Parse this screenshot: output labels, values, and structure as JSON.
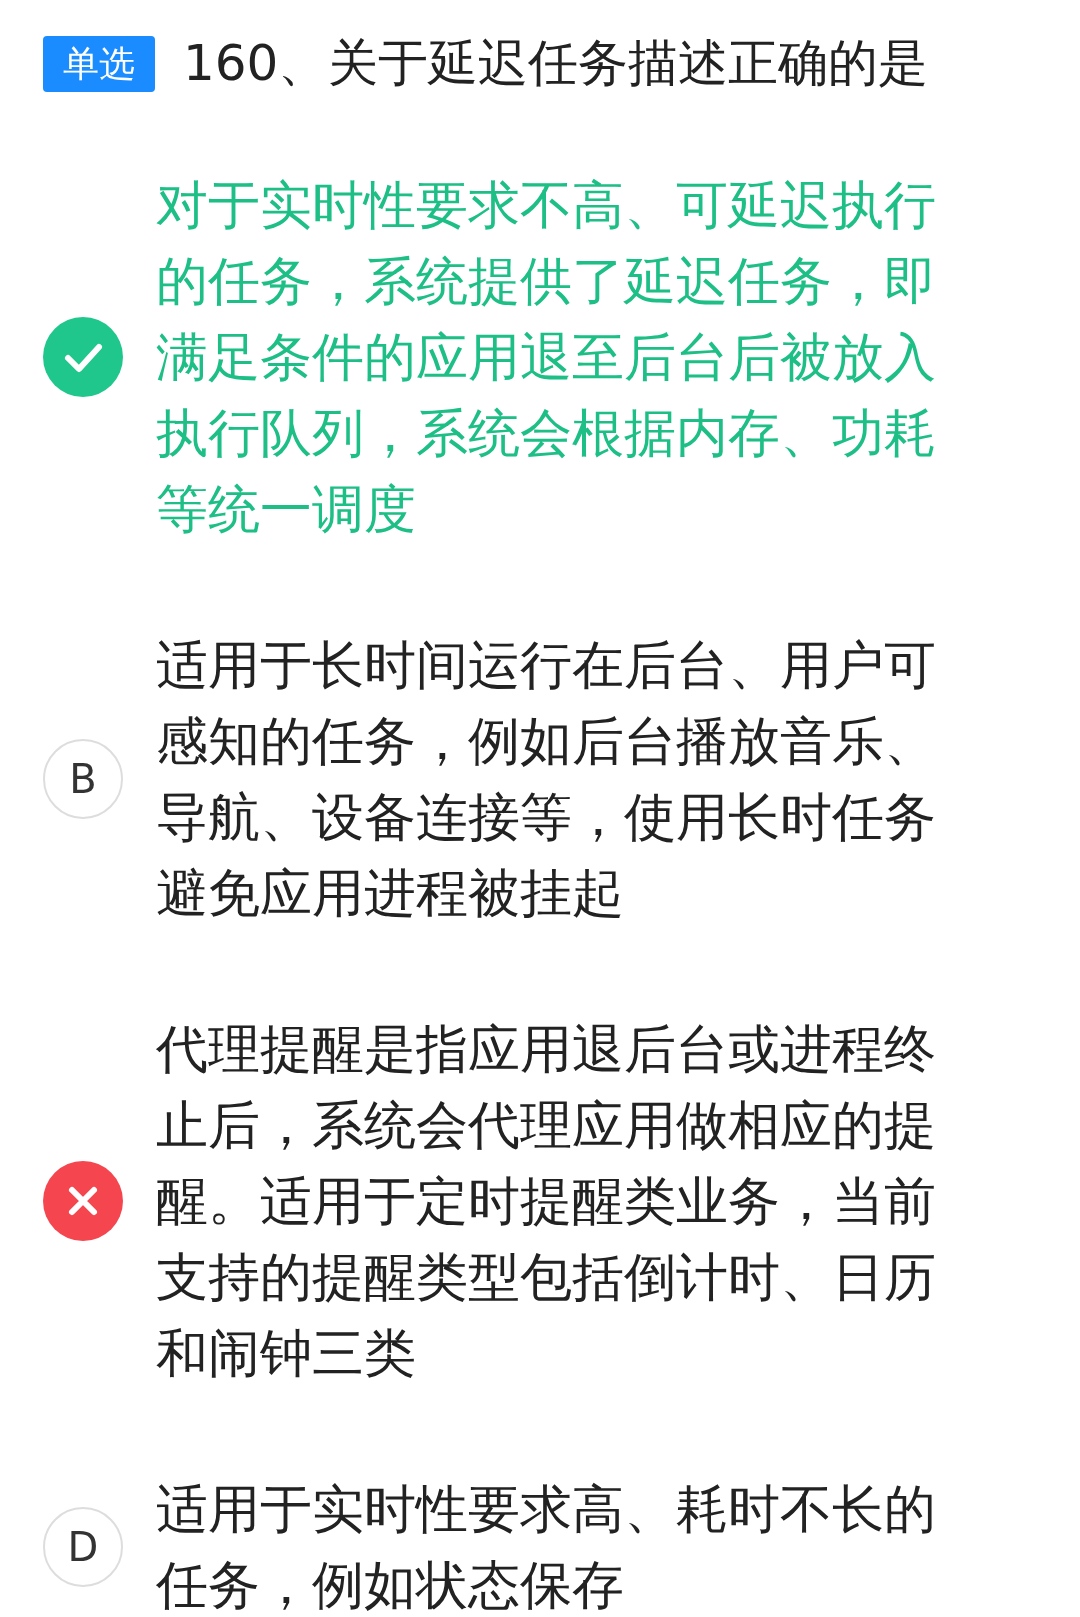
{
  "question": {
    "type_badge": "单选",
    "title": "160、关于延迟任务描述正确的是"
  },
  "options": [
    {
      "selected": true,
      "correct": true,
      "text": "对于实时性要求不高、可延迟执行的任务，系统提供了延迟任务，即满足条件的应用退至后台后被放入执行队列，系统会根据内存、功耗等统一调度"
    },
    {
      "selected": false,
      "correct": false,
      "letter": "B",
      "text": "适用于长时间运行在后台、用户可感知的任务，例如后台播放音乐、导航、设备连接等，使用长时任务避免应用进程被挂起"
    },
    {
      "selected": true,
      "correct": false,
      "text": "代理提醒是指应用退后台或进程终止后，系统会代理应用做相应的提醒。适用于定时提醒类业务，当前支持的提醒类型包括倒计时、日历和闹钟三类"
    },
    {
      "selected": false,
      "correct": false,
      "letter": "D",
      "text": "适用于实时性要求高、耗时不长的任务，例如状态保存"
    }
  ]
}
